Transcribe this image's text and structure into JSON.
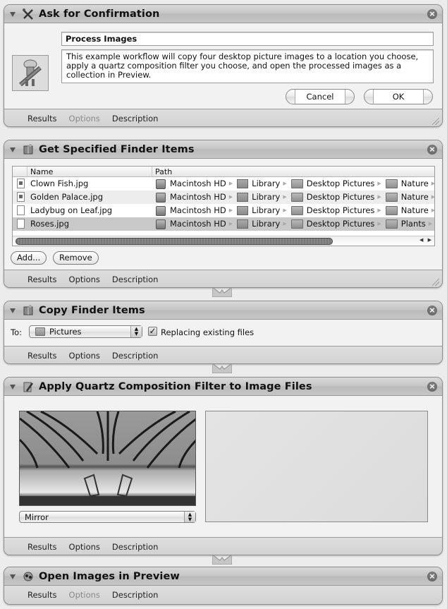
{
  "footer_tabs": {
    "results": "Results",
    "options": "Options",
    "description": "Description"
  },
  "actions": {
    "confirm": {
      "title": "Ask for Confirmation",
      "message_title": "Process Images",
      "message_body": "This example workflow will copy four desktop picture images to a location you choose, apply a quartz composition filter you choose, and open the processed images as a collection in Preview.",
      "cancel_label": "Cancel",
      "ok_label": "OK",
      "options_disabled": true
    },
    "get_items": {
      "title": "Get Specified Finder Items",
      "columns": {
        "name": "Name",
        "path": "Path"
      },
      "rows": [
        {
          "name": "Clown Fish.jpg",
          "path": [
            "Macintosh HD",
            "Library",
            "Desktop Pictures",
            "Nature"
          ]
        },
        {
          "name": "Golden Palace.jpg",
          "path": [
            "Macintosh HD",
            "Library",
            "Desktop Pictures",
            "Nature"
          ]
        },
        {
          "name": "Ladybug on Leaf.jpg",
          "path": [
            "Macintosh HD",
            "Library",
            "Desktop Pictures",
            "Nature"
          ]
        },
        {
          "name": "Roses.jpg",
          "path": [
            "Macintosh HD",
            "Library",
            "Desktop Pictures",
            "Plants"
          ]
        }
      ],
      "add_label": "Add...",
      "remove_label": "Remove"
    },
    "copy_items": {
      "title": "Copy Finder Items",
      "to_label": "To:",
      "destination": "Pictures",
      "replacing_label": "Replacing existing files",
      "replacing_checked": true
    },
    "quartz_filter": {
      "title": "Apply Quartz Composition Filter to Image Files",
      "filter": "Mirror"
    },
    "open_preview": {
      "title": "Open Images in Preview",
      "options_disabled": true
    }
  }
}
